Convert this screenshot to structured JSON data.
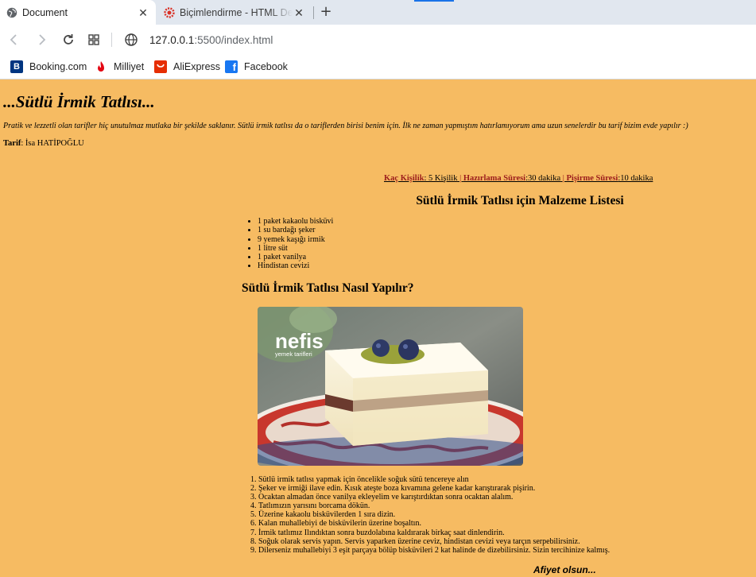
{
  "browser": {
    "tabs": [
      {
        "title": "Document",
        "active": true
      },
      {
        "title": "Biçimlendirme - HTML Ders",
        "active": false
      }
    ],
    "url_host": "127.0.0.1",
    "url_path": ":5500/index.html",
    "bookmarks": [
      {
        "label": "Booking.com",
        "icon": "booking-icon",
        "color": "#003580"
      },
      {
        "label": "Milliyet",
        "icon": "milliyet-icon",
        "color": "#e30613"
      },
      {
        "label": "AliExpress",
        "icon": "aliexpress-icon",
        "color": "#e62e04"
      },
      {
        "label": "Facebook",
        "icon": "facebook-icon",
        "color": "#1877f2"
      }
    ]
  },
  "page": {
    "background": "#f6bb62",
    "title": "...Sütlü İrmik Tatlısı...",
    "intro": "Pratik ve lezzetli olan tarifler hiç unutulmaz mutlaka bir şekilde saklanır. Sütlü irmik tatlısı da o tariflerden birisi benim için. İlk ne zaman yapmıştım hatırlamıyorum ama uzun senelerdir bu tarif bizim evde yapılır :)",
    "author_label": "Tarif",
    "author_name": ": İsa HATİPOĞLU",
    "info": {
      "servings_label": "Kaç Kişilik",
      "servings_value": ": 5 Kişilik",
      "prep_label": "Hazırlama Süresi",
      "prep_value": ":30 dakika",
      "cook_label": "Pişirme Süresi",
      "cook_value": ":10 dakika",
      "separator": " | "
    },
    "ingredients_title": "Sütlü İrmik Tatlısı için Malzeme Listesi",
    "ingredients": [
      "1 paket kakaolu bisküvi",
      "1 su bardağı şeker",
      "9 yemek kaşığı irmik",
      "1 litre süt",
      "1 paket vanilya",
      "Hindistan cevizi"
    ],
    "steps_title": "Sütlü İrmik Tatlısı Nasıl Yapılır?",
    "photo_brand": "nefis",
    "photo_brand_sub": "yemek tarifleri",
    "steps": [
      "Sütlü irmik tatlısı yapmak için öncelikle soğuk sütü tencereye alın",
      "Şeker ve irmiği ilave edin. Kısık ateşte boza kıvamına gelene kadar karıştırarak pişirin.",
      "Ocaktan almadan önce vanilya ekleyelim ve karıştırdıktan sonra ocaktan alalım.",
      "Tatlımızın yarısını borcama dökün.",
      "Üzerine kakaolu bisküvilerden 1 sıra dizin.",
      "Kalan muhallebiyi de bisküvilerin üzerine boşaltın.",
      "İrmik tatlımız Ilındıktan sonra buzdolabına kaldırarak birkaç saat dinlendirin.",
      "Soğuk olarak servis yapın. Servis yaparken üzerine ceviz, hindistan cevizi veya tarçın serpebilirsiniz.",
      "Dilerseniz muhallebiyi 3 eşit parçaya bölüp bisküvileri 2 kat halinde de dizebilirsiniz. Sizin tercihinize kalmış."
    ],
    "closing": "Afiyet olsun..."
  }
}
